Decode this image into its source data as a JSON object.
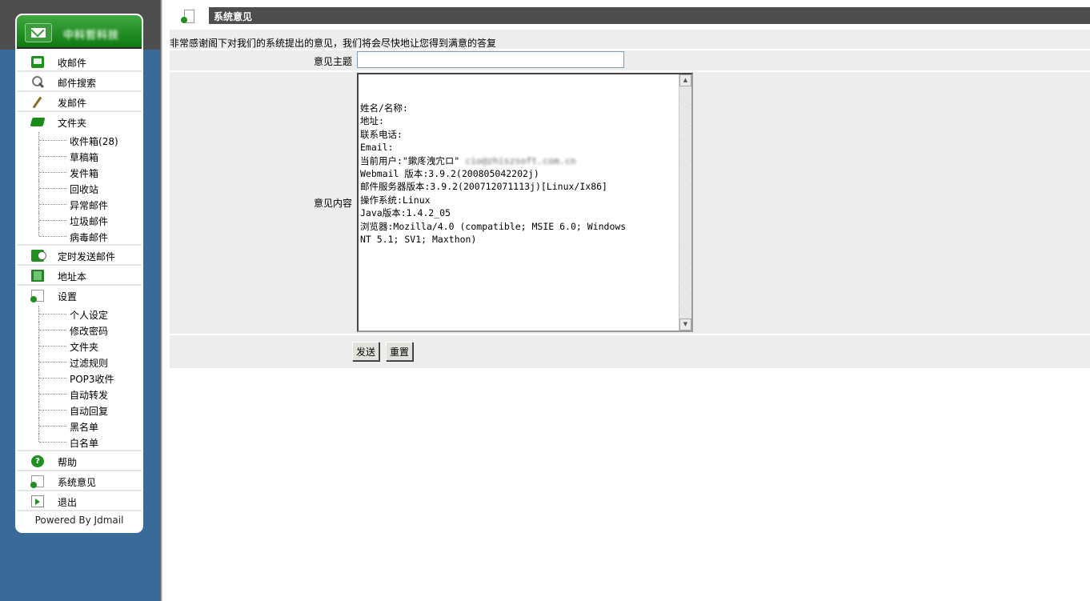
{
  "sidebar": {
    "brand": "中科哲科技",
    "items": [
      {
        "label": "收邮件"
      },
      {
        "label": "邮件搜索"
      },
      {
        "label": "发邮件"
      },
      {
        "label": "文件夹"
      },
      {
        "label": "定时发送邮件"
      },
      {
        "label": "地址本"
      },
      {
        "label": "设置"
      },
      {
        "label": "帮助"
      },
      {
        "label": "系统意见"
      },
      {
        "label": "退出"
      }
    ],
    "folders": [
      {
        "label": "收件箱",
        "count": "(28)"
      },
      {
        "label": "草稿箱"
      },
      {
        "label": "发件箱"
      },
      {
        "label": "回收站"
      },
      {
        "label": "异常邮件"
      },
      {
        "label": "垃圾邮件"
      },
      {
        "label": "病毒邮件"
      }
    ],
    "settings": [
      {
        "label": "个人设定"
      },
      {
        "label": "修改密码"
      },
      {
        "label": "文件夹"
      },
      {
        "label": "过滤规则"
      },
      {
        "label": "POP3收件"
      },
      {
        "label": "自动转发"
      },
      {
        "label": "自动回复"
      },
      {
        "label": "黑名单"
      },
      {
        "label": "白名单"
      }
    ],
    "powered": "Powered By Jdmail",
    "help_glyph": "?"
  },
  "page": {
    "title": "系统意见",
    "intro": "非常感谢阁下对我们的系统提出的意见，我们将会尽快地让您得到满意的答复",
    "subject_label": "意见主题",
    "subject_value": "",
    "content_label": "意见内容",
    "content_lines": [
      "姓名/名称:",
      "地址:",
      "联系电话:",
      "Email:",
      "当前用户:\"鏉庝洩宂ロ\" ",
      "Webmail 版本:3.9.2(20080504220​2j)",
      "邮件服务器版本:3.9.2(200712071113j)[Linux/Ix86]",
      "操作系统:Linux",
      "Java版本:1.4.2_05",
      "浏览器:Mozilla/4.0 (compatible; MSIE 6.0; Windows",
      "NT 5.1; SV1; Maxthon)"
    ],
    "current_user_email": "cio@zhiszsoft.com.cn",
    "send_label": "发送",
    "reset_label": "重置",
    "scroll_up": "▲",
    "scroll_down": "▼"
  },
  "colors": {
    "sidebar_bg": "#3a6a99",
    "header_bar": "#4e4e4e",
    "brand_green": "#1f8f1f",
    "row_bg": "#ededed"
  },
  "icons": {
    "inbox": "mail-icon",
    "search": "search-icon",
    "compose": "pen-icon",
    "folders": "folder-icon",
    "scheduled": "timer-mail-icon",
    "addressbook": "book-icon",
    "settings": "document-icon",
    "help": "help-icon",
    "feedback": "document-icon",
    "logout": "exit-icon"
  }
}
